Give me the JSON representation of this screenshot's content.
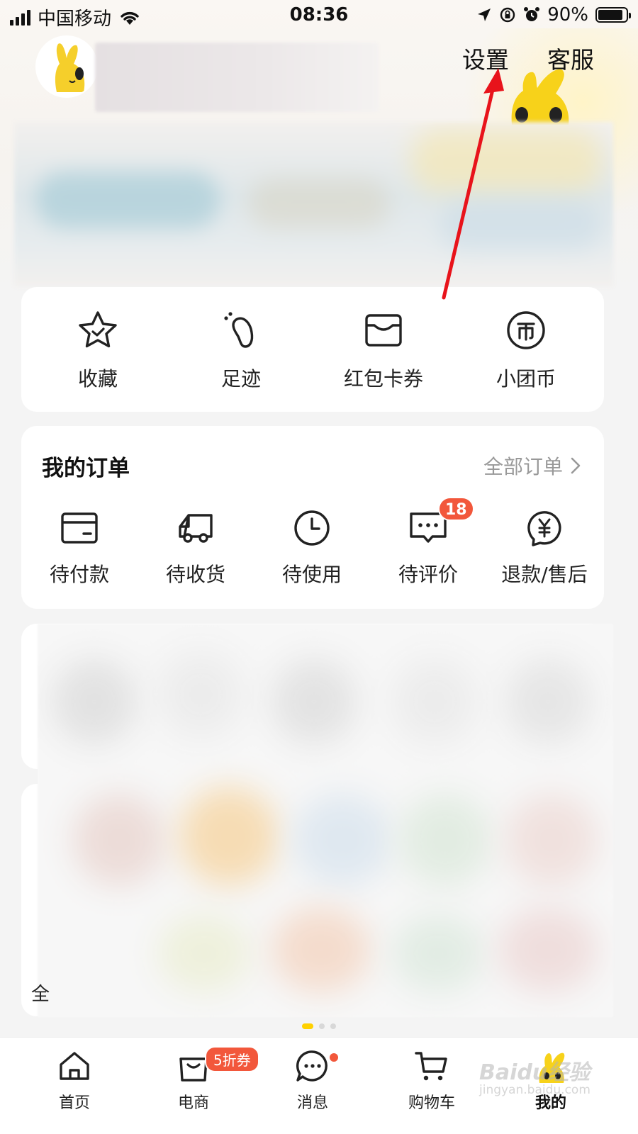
{
  "status_bar": {
    "carrier": "中国移动",
    "time": "08:36",
    "battery_percent": "90%",
    "battery_level": 0.9,
    "icons": [
      "signal-icon",
      "wifi-icon",
      "location-icon",
      "orientation-lock-icon",
      "alarm-icon",
      "battery-icon"
    ]
  },
  "header": {
    "settings_label": "设置",
    "service_label": "客服"
  },
  "shortcuts": [
    {
      "label": "收藏",
      "icon": "star-icon"
    },
    {
      "label": "足迹",
      "icon": "footprint-icon"
    },
    {
      "label": "红包卡券",
      "icon": "wallet-icon"
    },
    {
      "label": "小团币",
      "icon": "coin-icon"
    }
  ],
  "orders": {
    "title": "我的订单",
    "all_label": "全部订单",
    "items": [
      {
        "label": "待付款",
        "icon": "card-icon"
      },
      {
        "label": "待收货",
        "icon": "truck-icon"
      },
      {
        "label": "待使用",
        "icon": "clock-icon"
      },
      {
        "label": "待评价",
        "icon": "comment-icon",
        "badge": "18"
      },
      {
        "label": "退款/售后",
        "icon": "refund-icon"
      }
    ]
  },
  "content": {
    "partial_text": "全"
  },
  "tabbar": {
    "tabs": [
      {
        "label": "首页",
        "icon": "home-icon"
      },
      {
        "label": "电商",
        "icon": "shopping-bag-icon",
        "badge": "5折券"
      },
      {
        "label": "消息",
        "icon": "message-icon"
      },
      {
        "label": "购物车",
        "icon": "cart-icon"
      },
      {
        "label": "我的",
        "icon": "mascot-icon",
        "active": true
      }
    ]
  },
  "watermark": {
    "text": "Baidu经验",
    "sub": "jingyan.baidu.com"
  },
  "colors": {
    "accent_red": "#f2573b",
    "brand_yellow": "#ffd100",
    "annotation_arrow": "#e8131b"
  }
}
